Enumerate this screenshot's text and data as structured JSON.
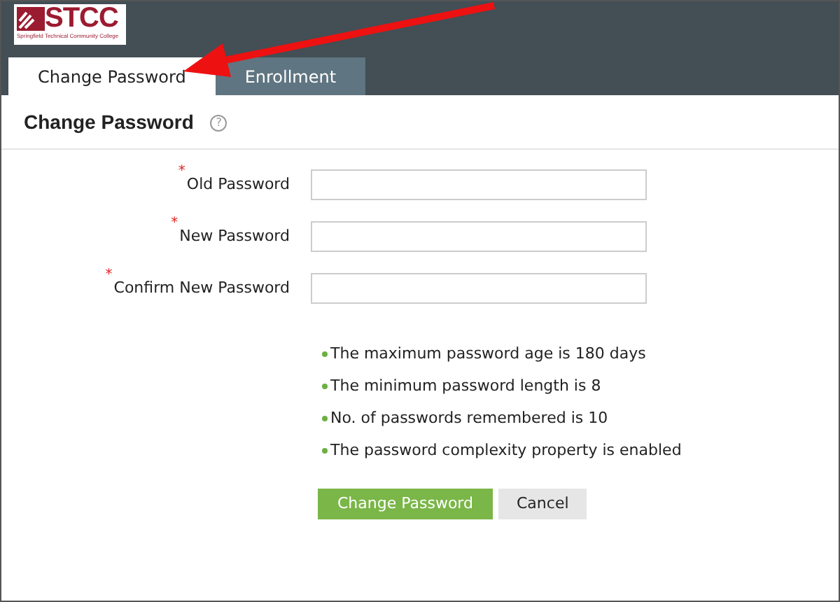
{
  "logo": {
    "mark": "STCC",
    "subtitle": "Springfield Technical Community College"
  },
  "tabs": [
    {
      "label": "Change Password",
      "selected": true
    },
    {
      "label": "Enrollment",
      "selected": false
    }
  ],
  "page_title": "Change Password",
  "help": "?",
  "fields": [
    {
      "label": "Old Password",
      "required": true
    },
    {
      "label": "New Password",
      "required": true
    },
    {
      "label": "Confirm New Password",
      "required": true
    }
  ],
  "required_mark": "*",
  "rules": [
    "The maximum password age is 180 days",
    "The minimum password length is 8",
    "No. of passwords remembered is 10",
    "The password complexity property is enabled"
  ],
  "buttons": [
    {
      "label": "Change Password",
      "kind": "primary"
    },
    {
      "label": "Cancel",
      "kind": "secondary"
    }
  ]
}
